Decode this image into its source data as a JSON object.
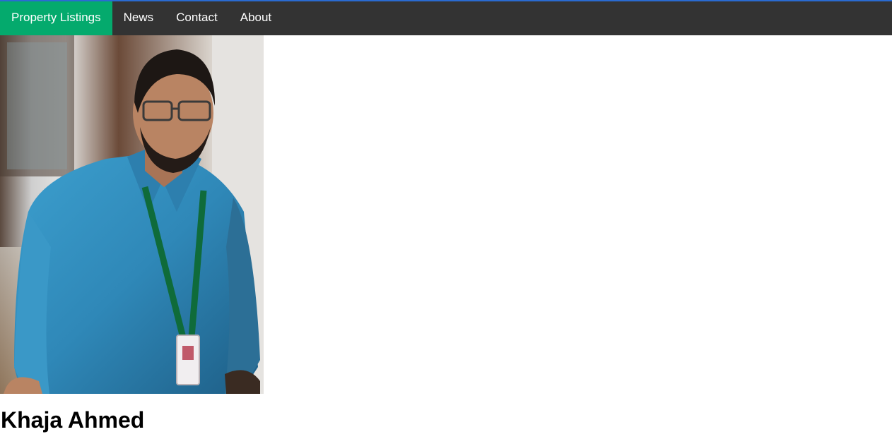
{
  "nav": {
    "items": [
      {
        "label": "Property Listings",
        "active": true
      },
      {
        "label": "News",
        "active": false
      },
      {
        "label": "Contact",
        "active": false
      },
      {
        "label": "About",
        "active": false
      }
    ],
    "active_color": "#04aa6d",
    "bar_color": "#333333"
  },
  "profile": {
    "name": "Khaja Ahmed",
    "photo_icon": "person-portrait-photo"
  }
}
